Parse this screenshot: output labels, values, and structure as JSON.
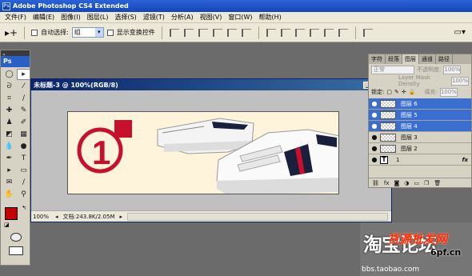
{
  "app": {
    "title": "Adobe Photoshop CS4 Extended",
    "icon_text": "Ps"
  },
  "menu": [
    "文件(F)",
    "编辑(E)",
    "图像(I)",
    "图层(L)",
    "选择(S)",
    "滤镜(T)",
    "分析(A)",
    "视图(V)",
    "窗口(W)",
    "帮助(H)"
  ],
  "options": {
    "auto_select_label": "自动选择:",
    "auto_select_value": "组",
    "show_transform_label": "显示变换控件"
  },
  "toolbox": {
    "title": "Ps",
    "collapse": "«",
    "tools": [
      "dashed-ellipse-icon",
      "move-icon",
      "lasso-icon",
      "wand-icon",
      "crop-icon",
      "eyedropper-icon",
      "healing-icon",
      "brush-icon",
      "stamp-icon",
      "history-brush-icon",
      "eraser-icon",
      "gradient-icon",
      "blur-icon",
      "dodge-icon",
      "pen-icon",
      "type-icon",
      "path-select-icon",
      "shape-icon",
      "notes-icon",
      "eyedropper2-icon",
      "hand-icon",
      "zoom-icon"
    ],
    "fg_color": "#c40000",
    "bg_color": "#ffffff"
  },
  "document": {
    "title": "未标题-3 @ 100%(RGB/8)",
    "zoom": "100%",
    "doc_size": "文档:243.8K/2.05M",
    "badge_number": "1",
    "accent_color": "#c8102e"
  },
  "panel": {
    "tabs": [
      "字符",
      "段落",
      "图层",
      "通道",
      "路径"
    ],
    "active_tab": "图层",
    "blend_mode": "正常",
    "opacity_label": "不透明度:",
    "opacity_value": "100%",
    "density_label": "Layer Mask Density",
    "density_value": "100%",
    "lock_label": "锁定:",
    "fill_label": "填充:",
    "fill_value": "100%",
    "layers": [
      {
        "name": "图层 6",
        "selected": true,
        "type": "raster"
      },
      {
        "name": "图层 5",
        "selected": true,
        "type": "raster"
      },
      {
        "name": "图层 4",
        "selected": true,
        "type": "raster"
      },
      {
        "name": "图层 3",
        "selected": false,
        "type": "raster"
      },
      {
        "name": "图层 2",
        "selected": false,
        "type": "raster"
      },
      {
        "name": "1",
        "selected": false,
        "type": "text",
        "fx": "fx"
      }
    ]
  },
  "watermark": {
    "big_text": "淘宝论坛",
    "red_text": "货源批发网",
    "site": "6pf.cn",
    "bbs": "bbs.taobao.com"
  }
}
